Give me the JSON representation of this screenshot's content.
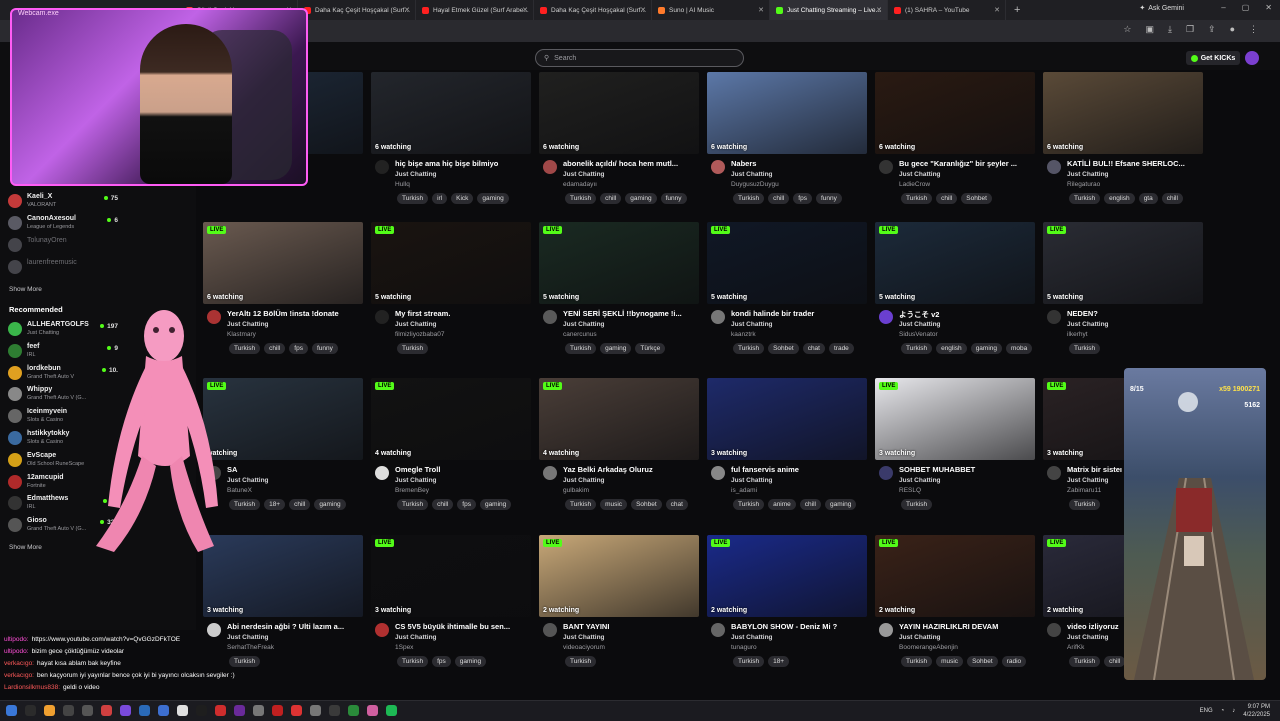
{
  "browser": {
    "tabs": [
      {
        "label": "Söyli Canlı Ya",
        "color": "#ff3b3b",
        "active": false
      },
      {
        "label": "Daha Kaç Çeşit Hoşçakal (Surf...",
        "color": "#ff2020",
        "active": false
      },
      {
        "label": "Hayal Etmek Güzel (Surf Arabe...",
        "color": "#ff2020",
        "active": false
      },
      {
        "label": "Daha Kaç Çeşit Hoşçakal (Surf...",
        "color": "#ff2020",
        "active": false
      },
      {
        "label": "Suno | AI Music",
        "color": "#ff7a2b",
        "active": false
      },
      {
        "label": "Just Chatting Streaming – Live...",
        "color": "#53fc18",
        "active": true
      },
      {
        "label": "(1) SAHRA – YouTube",
        "color": "#ff2020",
        "active": false
      }
    ],
    "new_tab": "+",
    "ask_gemini": "Ask Gemini"
  },
  "header": {
    "search_placeholder": "Search",
    "get_kicks": "Get KICKs"
  },
  "webcam_label": "Webcam.exe",
  "sidebar": {
    "following": [
      {
        "name": "Kaeli_X",
        "game": "VALORANT",
        "count": "75",
        "color": "#c43a3a",
        "live": true
      },
      {
        "name": "CanonAxesoul",
        "game": "League of Legends",
        "count": "6",
        "color": "#5a5a64",
        "live": true
      },
      {
        "name": "TolunayOren",
        "game": "",
        "count": "",
        "color": "#44444a",
        "live": false
      },
      {
        "name": "laurenfreemusic",
        "game": "",
        "count": "",
        "color": "#44444a",
        "live": false
      }
    ],
    "show_more_1": "Show More",
    "recommended_title": "Recommended",
    "recommended": [
      {
        "name": "ALLHEARTGOLFS",
        "game": "Just Chatting",
        "count": "197",
        "color": "#3ab54a"
      },
      {
        "name": "feef",
        "game": "IRL",
        "count": "9",
        "color": "#2e7d32"
      },
      {
        "name": "lordkebun",
        "game": "Grand Theft Auto V",
        "count": "10.",
        "color": "#e0a020"
      },
      {
        "name": "Whippy",
        "game": "Grand Theft Auto V (G...",
        "count": "",
        "color": "#888"
      },
      {
        "name": "Iceinmyvein",
        "game": "Slots & Casino",
        "count": "",
        "color": "#666"
      },
      {
        "name": "hstikkytokky",
        "game": "Slots & Casino",
        "count": "",
        "color": "#3a6aa0"
      },
      {
        "name": "EvScape",
        "game": "Old School RuneScape",
        "count": "",
        "color": "#d4a017"
      },
      {
        "name": "12amcupid",
        "game": "Fortnite",
        "count": "",
        "color": "#b02a2a"
      },
      {
        "name": "Edmatthews",
        "game": "IRL",
        "count": "5K",
        "color": "#333"
      },
      {
        "name": "Gioso",
        "game": "Grand Theft Auto V (G...",
        "count": "329",
        "color": "#555"
      }
    ],
    "show_more_2": "Show More"
  },
  "streams": [
    {
      "title": "",
      "category": "",
      "user": "",
      "watching": "",
      "tags": [],
      "thumb": "#1e2a3a",
      "avatar": "#444",
      "live": false
    },
    {
      "title": "hiç bişe ama hiç bişe bilmiyo",
      "category": "Just Chatting",
      "user": "Hullq",
      "watching": "6 watching",
      "tags": [
        "Turkish",
        "irl",
        "Kick",
        "gaming"
      ],
      "thumb": "#23262c",
      "avatar": "#222",
      "live": false
    },
    {
      "title": "abonelik açıldı/ hoca hem mutl...",
      "category": "Just Chatting",
      "user": "edamadayıı",
      "watching": "6 watching",
      "tags": [
        "Turkish",
        "chill",
        "gaming",
        "funny"
      ],
      "thumb": "#20201f",
      "avatar": "#a04848",
      "live": false
    },
    {
      "title": "Nabers",
      "category": "Just Chatting",
      "user": "DuygusuzDuygu",
      "watching": "6 watching",
      "tags": [
        "Turkish",
        "chill",
        "fps",
        "funny"
      ],
      "thumb": "#5c78a8",
      "avatar": "#b05a5a",
      "live": false
    },
    {
      "title": "Bu gece \"Karanlığız\" bir şeyler ...",
      "category": "Just Chatting",
      "user": "LadieCrow",
      "watching": "6 watching",
      "tags": [
        "Turkish",
        "chill",
        "Sohbet"
      ],
      "thumb": "#2a1a12",
      "avatar": "#333",
      "live": false
    },
    {
      "title": "KATİLİ BUL!! Efsane SHERLOC...",
      "category": "Just Chatting",
      "user": "Rilegaturao",
      "watching": "6 watching",
      "tags": [
        "Turkish",
        "english",
        "gta",
        "chill"
      ],
      "thumb": "#5a4a38",
      "avatar": "#556",
      "live": false
    },
    {
      "title": "YerAltı 12 BölÜm !insta !donate",
      "category": "Just Chatting",
      "user": "Klastmary",
      "watching": "6 watching",
      "tags": [
        "Turkish",
        "chill",
        "fps",
        "funny"
      ],
      "thumb": "#6a5a50",
      "avatar": "#a33",
      "live": true
    },
    {
      "title": "My first stream.",
      "category": "Just Chatting",
      "user": "filmizliyozbaba07",
      "watching": "5 watching",
      "tags": [
        "Turkish"
      ],
      "thumb": "#1a1410",
      "avatar": "#222",
      "live": true
    },
    {
      "title": "YENİ SERİ ŞEKLİ !!bynogame !i...",
      "category": "Just Chatting",
      "user": "canercunus",
      "watching": "5 watching",
      "tags": [
        "Turkish",
        "gaming",
        "Türkçe"
      ],
      "thumb": "#1a2a22",
      "avatar": "#5a5a5a",
      "live": true
    },
    {
      "title": "kondi halinde bir trader",
      "category": "Just Chatting",
      "user": "kaanztrk",
      "watching": "5 watching",
      "tags": [
        "Turkish",
        "Sohbet",
        "chat",
        "trade"
      ],
      "thumb": "#101826",
      "avatar": "#777",
      "live": true
    },
    {
      "title": "ようこそ v2",
      "category": "Just Chatting",
      "user": "SidusVenator",
      "watching": "5 watching",
      "tags": [
        "Turkish",
        "english",
        "gaming",
        "moba"
      ],
      "thumb": "#1c2a3a",
      "avatar": "#6a3fd0",
      "live": true
    },
    {
      "title": "NEDEN?",
      "category": "Just Chatting",
      "user": "ilkerhyt",
      "watching": "5 watching",
      "tags": [
        "Turkish"
      ],
      "thumb": "#2a2c34",
      "avatar": "#333",
      "live": true
    },
    {
      "title": "SA",
      "category": "Just Chatting",
      "user": "BatuneX",
      "watching": "watching",
      "tags": [
        "Turkish",
        "18+",
        "chill",
        "gaming"
      ],
      "thumb": "#28333f",
      "avatar": "#444",
      "live": true
    },
    {
      "title": "Omegle Troll",
      "category": "Just Chatting",
      "user": "BremenBey",
      "watching": "4 watching",
      "tags": [
        "Turkish",
        "chill",
        "fps",
        "gaming"
      ],
      "thumb": "#121212",
      "avatar": "#ddd",
      "live": true
    },
    {
      "title": "Yaz Belki Arkadaş Oluruz",
      "category": "Just Chatting",
      "user": "gulbakim",
      "watching": "4 watching",
      "tags": [
        "Turkish",
        "music",
        "Sohbet",
        "chat"
      ],
      "thumb": "#4a3e38",
      "avatar": "#777",
      "live": true
    },
    {
      "title": "ful fanservis anime",
      "category": "Just Chatting",
      "user": "is_adami",
      "watching": "3 watching",
      "tags": [
        "Turkish",
        "anime",
        "chill",
        "gaming"
      ],
      "thumb": "#1e2a6a",
      "avatar": "#888",
      "live": false
    },
    {
      "title": "SOHBET MUHABBET",
      "category": "Just Chatting",
      "user": "RESLQ",
      "watching": "3 watching",
      "tags": [
        "Turkish"
      ],
      "thumb": "#e8e8ec",
      "avatar": "#3a3a6a",
      "live": true
    },
    {
      "title": "Matrix bir sisteı",
      "category": "Just Chatting",
      "user": "Zabimaru11",
      "watching": "3 watching",
      "tags": [
        "Turkish"
      ],
      "thumb": "#2a2224",
      "avatar": "#444",
      "live": true
    },
    {
      "title": "Abi nerdesin ağbi ? Ulti lazım a...",
      "category": "Just Chatting",
      "user": "SerhatTheFreak",
      "watching": "3 watching",
      "tags": [
        "Turkish"
      ],
      "thumb": "#2a3a5a",
      "avatar": "#ccc",
      "live": false
    },
    {
      "title": "CS 5V5 büyük ihtimalle bu sen...",
      "category": "Just Chatting",
      "user": "1Spex",
      "watching": "3 watching",
      "tags": [
        "Turkish",
        "fps",
        "gaming"
      ],
      "thumb": "#0e0e10",
      "avatar": "#b03030",
      "live": true
    },
    {
      "title": "BANT YAYINI",
      "category": "Just Chatting",
      "user": "videoaciyorum",
      "watching": "2 watching",
      "tags": [
        "Turkish"
      ],
      "thumb": "#c8a878",
      "avatar": "#555",
      "live": true
    },
    {
      "title": "BABYLON SHOW - Deniz Mi ?",
      "category": "Just Chatting",
      "user": "tunaguro",
      "watching": "2 watching",
      "tags": [
        "Turkish",
        "18+"
      ],
      "thumb": "#1a2a8a",
      "avatar": "#666",
      "live": true
    },
    {
      "title": "YAYIN HAZIRLIKLRI DEVAM",
      "category": "Just Chatting",
      "user": "BoomerangeAbenjin",
      "watching": "2 watching",
      "tags": [
        "Turkish",
        "music",
        "Sohbet",
        "radio"
      ],
      "thumb": "#3a2218",
      "avatar": "#999",
      "live": true
    },
    {
      "title": "video izliyoruz",
      "category": "Just Chatting",
      "user": "ArifKk",
      "watching": "2 watching",
      "tags": [
        "Turkish",
        "chill"
      ],
      "thumb": "#2a2a3a",
      "avatar": "#444",
      "live": true
    }
  ],
  "mobile_game": {
    "hud_left": "8/15",
    "hud_right": "x59 1900271",
    "score": "5162"
  },
  "chat": [
    {
      "user": "ultipodo:",
      "text": "https://www.youtube.com/watch?v=QvGGzDFkTOE"
    },
    {
      "user": "ultipodo:",
      "text": "bizim gece çöktüğümüz videolar"
    },
    {
      "user": "verkacıgo:",
      "text": "hayat kısa ablam bak keyfine"
    },
    {
      "user": "verkacıgo:",
      "text": "ben kaçyorum iyi yayınlar bence çok iyi bi yayıncı olcaksın sevgiler :)"
    },
    {
      "user": "Lardionsilkmus838:",
      "text": "geldi o video"
    }
  ],
  "clock": {
    "time": "9:07 PM",
    "date": "4/22/2025",
    "lang": "ENG"
  }
}
